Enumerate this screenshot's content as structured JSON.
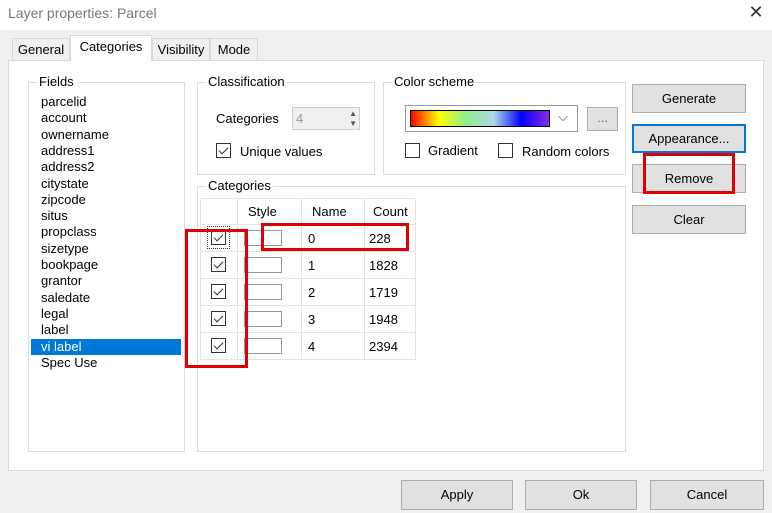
{
  "window": {
    "title": "Layer properties: Parcel",
    "close_icon": "close-icon"
  },
  "tabs": [
    {
      "label": "General"
    },
    {
      "label": "Categories",
      "selected": true
    },
    {
      "label": "Visibility"
    },
    {
      "label": "Mode"
    }
  ],
  "fields": {
    "legend": "Fields",
    "items": [
      "parcelid",
      "account",
      "ownername",
      "address1",
      "address2",
      "citystate",
      "zipcode",
      "situs",
      "propclass",
      "sizetype",
      "bookpage",
      "grantor",
      "saledate",
      "legal",
      "label",
      "vi label",
      "Spec Use"
    ],
    "selected": "vi label"
  },
  "classification": {
    "legend": "Classification",
    "categories_label": "Categories",
    "categories_value": "4",
    "unique_values_label": "Unique values",
    "unique_values_checked": true
  },
  "color_scheme": {
    "legend": "Color scheme",
    "gradient_colors": [
      "#ff0000",
      "#ffff00",
      "#90ee90",
      "#add8e6",
      "#0000ff",
      "#8a2be2"
    ],
    "more_button": "...",
    "gradient_label": "Gradient",
    "gradient_checked": false,
    "random_label": "Random colors",
    "random_checked": false
  },
  "categories": {
    "legend": "Categories",
    "headers": [
      "",
      "Style",
      "Name",
      "Count"
    ],
    "rows": [
      {
        "checked": true,
        "name": "0",
        "count": "228"
      },
      {
        "checked": true,
        "name": "1",
        "count": "1828"
      },
      {
        "checked": true,
        "name": "2",
        "count": "1719"
      },
      {
        "checked": true,
        "name": "3",
        "count": "1948"
      },
      {
        "checked": true,
        "name": "4",
        "count": "2394"
      }
    ]
  },
  "side_buttons": {
    "generate": "Generate",
    "appearance": "Appearance...",
    "remove": "Remove",
    "clear": "Clear"
  },
  "footer": {
    "apply": "Apply",
    "ok": "Ok",
    "cancel": "Cancel"
  },
  "highlight_color": "#e00000"
}
